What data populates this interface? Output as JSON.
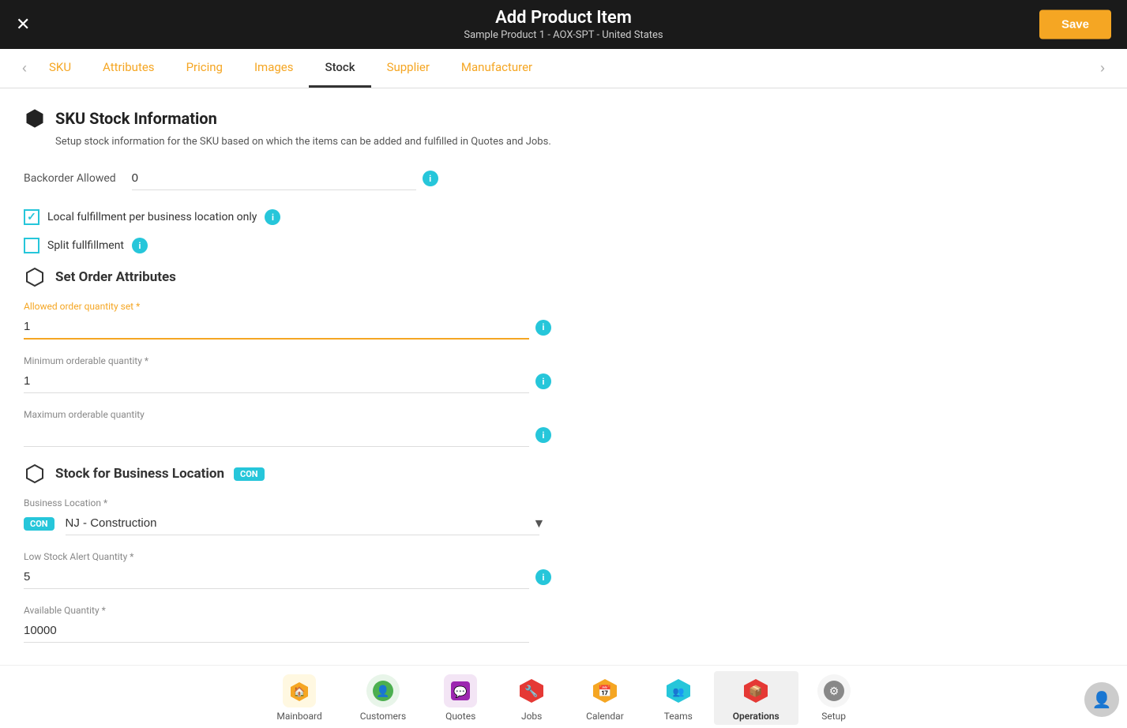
{
  "header": {
    "title": "Add Product Item",
    "subtitle": "Sample Product 1 - AOX-SPT - United States",
    "save_label": "Save",
    "close_icon": "✕"
  },
  "tabs": [
    {
      "id": "sku",
      "label": "SKU",
      "active": false
    },
    {
      "id": "attributes",
      "label": "Attributes",
      "active": false
    },
    {
      "id": "pricing",
      "label": "Pricing",
      "active": false
    },
    {
      "id": "images",
      "label": "Images",
      "active": false
    },
    {
      "id": "stock",
      "label": "Stock",
      "active": true
    },
    {
      "id": "supplier",
      "label": "Supplier",
      "active": false
    },
    {
      "id": "manufacturer",
      "label": "Manufacturer",
      "active": false
    }
  ],
  "sku_stock": {
    "section_title": "SKU Stock Information",
    "section_desc": "Setup stock information for the SKU based on which the items can be added and fulfilled in Quotes and Jobs.",
    "backorder_label": "Backorder Allowed",
    "backorder_value": "0",
    "local_fulfillment_label": "Local fulfillment per business location only",
    "local_fulfillment_checked": true,
    "split_fulfillment_label": "Split fullfillment",
    "split_fulfillment_checked": false
  },
  "order_attributes": {
    "section_title": "Set Order Attributes",
    "allowed_qty_label": "Allowed order quantity set *",
    "allowed_qty_value": "1",
    "min_qty_label": "Minimum orderable quantity *",
    "min_qty_value": "1",
    "max_qty_label": "Maximum orderable quantity"
  },
  "stock_location": {
    "section_title": "Stock for Business Location",
    "badge_label": "CON",
    "business_location_label": "Business Location *",
    "business_location_badge": "CON",
    "business_location_value": "NJ - Construction",
    "low_stock_label": "Low Stock Alert Quantity *",
    "low_stock_value": "5",
    "available_qty_label": "Available Quantity *",
    "available_qty_value": "10000"
  },
  "bottom_nav": [
    {
      "id": "mainboard",
      "label": "Mainboard",
      "icon": "🏠",
      "color": "#f5a623",
      "active": false
    },
    {
      "id": "customers",
      "label": "Customers",
      "icon": "👤",
      "color": "#4caf50",
      "active": false
    },
    {
      "id": "quotes",
      "label": "Quotes",
      "icon": "💬",
      "color": "#9c27b0",
      "active": false
    },
    {
      "id": "jobs",
      "label": "Jobs",
      "icon": "🔧",
      "color": "#e53935",
      "active": false
    },
    {
      "id": "calendar",
      "label": "Calendar",
      "icon": "📅",
      "color": "#f5a623",
      "active": false
    },
    {
      "id": "teams",
      "label": "Teams",
      "icon": "👥",
      "color": "#26c6da",
      "active": false
    },
    {
      "id": "operations",
      "label": "Operations",
      "icon": "📦",
      "color": "#e53935",
      "active": true
    },
    {
      "id": "setup",
      "label": "Setup",
      "icon": "⚙️",
      "color": "#888",
      "active": false
    }
  ]
}
